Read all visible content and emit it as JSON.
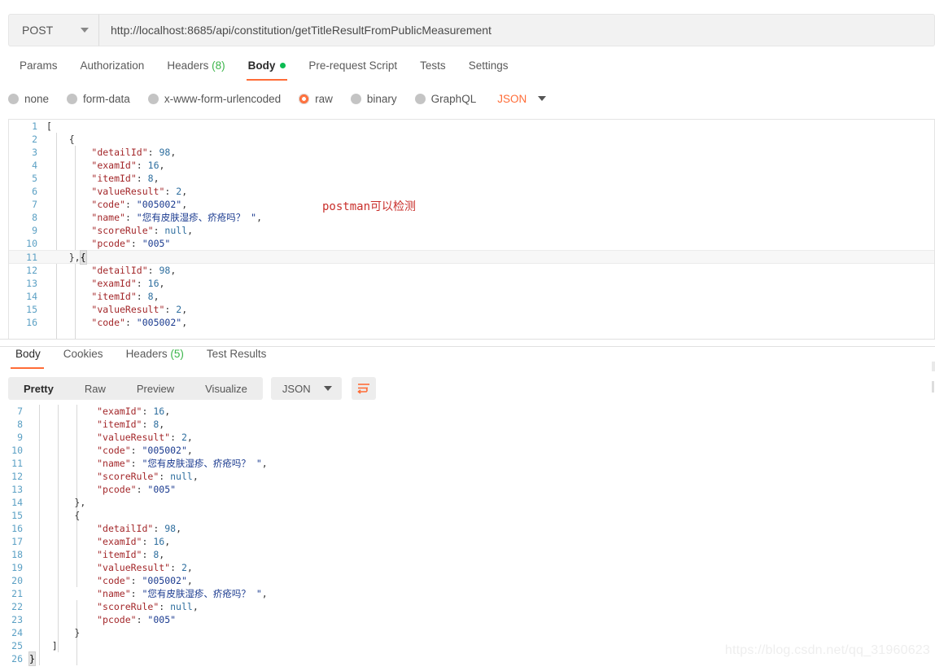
{
  "request": {
    "method": "POST",
    "url": "http://localhost:8685/api/constitution/getTitleResultFromPublicMeasurement",
    "tabs": [
      {
        "label": "Params",
        "active": false,
        "count": "",
        "dot": false
      },
      {
        "label": "Authorization",
        "active": false,
        "count": "",
        "dot": false
      },
      {
        "label": "Headers",
        "active": false,
        "count": "(8)",
        "dot": false
      },
      {
        "label": "Body",
        "active": true,
        "count": "",
        "dot": true
      },
      {
        "label": "Pre-request Script",
        "active": false,
        "count": "",
        "dot": false
      },
      {
        "label": "Tests",
        "active": false,
        "count": "",
        "dot": false
      },
      {
        "label": "Settings",
        "active": false,
        "count": "",
        "dot": false
      }
    ],
    "body_types": [
      {
        "label": "none",
        "checked": false
      },
      {
        "label": "form-data",
        "checked": false
      },
      {
        "label": "x-www-form-urlencoded",
        "checked": false
      },
      {
        "label": "raw",
        "checked": true
      },
      {
        "label": "binary",
        "checked": false
      },
      {
        "label": "GraphQL",
        "checked": false
      }
    ],
    "format": "JSON",
    "code_lines": [
      {
        "n": "1",
        "indent": 0,
        "tokens": [
          {
            "t": "[",
            "c": "br"
          }
        ],
        "hl": false
      },
      {
        "n": "2",
        "indent": 1,
        "tokens": [
          {
            "t": "{",
            "c": "br"
          }
        ],
        "hl": false
      },
      {
        "n": "3",
        "indent": 2,
        "tokens": [
          {
            "t": "\"detailId\"",
            "c": "k"
          },
          {
            "t": ": ",
            "c": "p"
          },
          {
            "t": "98",
            "c": "n"
          },
          {
            "t": ",",
            "c": "p"
          }
        ],
        "hl": false
      },
      {
        "n": "4",
        "indent": 2,
        "tokens": [
          {
            "t": "\"examId\"",
            "c": "k"
          },
          {
            "t": ": ",
            "c": "p"
          },
          {
            "t": "16",
            "c": "n"
          },
          {
            "t": ",",
            "c": "p"
          }
        ],
        "hl": false
      },
      {
        "n": "5",
        "indent": 2,
        "tokens": [
          {
            "t": "\"itemId\"",
            "c": "k"
          },
          {
            "t": ": ",
            "c": "p"
          },
          {
            "t": "8",
            "c": "n"
          },
          {
            "t": ",",
            "c": "p"
          }
        ],
        "hl": false
      },
      {
        "n": "6",
        "indent": 2,
        "tokens": [
          {
            "t": "\"valueResult\"",
            "c": "k"
          },
          {
            "t": ": ",
            "c": "p"
          },
          {
            "t": "2",
            "c": "n"
          },
          {
            "t": ",",
            "c": "p"
          }
        ],
        "hl": false
      },
      {
        "n": "7",
        "indent": 2,
        "tokens": [
          {
            "t": "\"code\"",
            "c": "k"
          },
          {
            "t": ": ",
            "c": "p"
          },
          {
            "t": "\"005002\"",
            "c": "s"
          },
          {
            "t": ",",
            "c": "p"
          }
        ],
        "hl": false
      },
      {
        "n": "8",
        "indent": 2,
        "tokens": [
          {
            "t": "\"name\"",
            "c": "k"
          },
          {
            "t": ": ",
            "c": "p"
          },
          {
            "t": "\"您有皮肤湿疹、疥疮吗？ \"",
            "c": "s"
          },
          {
            "t": ",",
            "c": "p"
          }
        ],
        "hl": false
      },
      {
        "n": "9",
        "indent": 2,
        "tokens": [
          {
            "t": "\"scoreRule\"",
            "c": "k"
          },
          {
            "t": ": ",
            "c": "p"
          },
          {
            "t": "null",
            "c": "nl"
          },
          {
            "t": ",",
            "c": "p"
          }
        ],
        "hl": false
      },
      {
        "n": "10",
        "indent": 2,
        "tokens": [
          {
            "t": "\"pcode\"",
            "c": "k"
          },
          {
            "t": ": ",
            "c": "p"
          },
          {
            "t": "\"005\"",
            "c": "s"
          }
        ],
        "hl": false
      },
      {
        "n": "11",
        "indent": 1,
        "tokens": [
          {
            "t": "},",
            "c": "br"
          },
          {
            "t": "{",
            "c": "cursor"
          }
        ],
        "hl": true
      },
      {
        "n": "12",
        "indent": 2,
        "tokens": [
          {
            "t": "\"detailId\"",
            "c": "k"
          },
          {
            "t": ": ",
            "c": "p"
          },
          {
            "t": "98",
            "c": "n"
          },
          {
            "t": ",",
            "c": "p"
          }
        ],
        "hl": false
      },
      {
        "n": "13",
        "indent": 2,
        "tokens": [
          {
            "t": "\"examId\"",
            "c": "k"
          },
          {
            "t": ": ",
            "c": "p"
          },
          {
            "t": "16",
            "c": "n"
          },
          {
            "t": ",",
            "c": "p"
          }
        ],
        "hl": false
      },
      {
        "n": "14",
        "indent": 2,
        "tokens": [
          {
            "t": "\"itemId\"",
            "c": "k"
          },
          {
            "t": ": ",
            "c": "p"
          },
          {
            "t": "8",
            "c": "n"
          },
          {
            "t": ",",
            "c": "p"
          }
        ],
        "hl": false
      },
      {
        "n": "15",
        "indent": 2,
        "tokens": [
          {
            "t": "\"valueResult\"",
            "c": "k"
          },
          {
            "t": ": ",
            "c": "p"
          },
          {
            "t": "2",
            "c": "n"
          },
          {
            "t": ",",
            "c": "p"
          }
        ],
        "hl": false
      },
      {
        "n": "16",
        "indent": 2,
        "tokens": [
          {
            "t": "\"code\"",
            "c": "k"
          },
          {
            "t": ": ",
            "c": "p"
          },
          {
            "t": "\"005002\"",
            "c": "s"
          },
          {
            "t": ",",
            "c": "p"
          }
        ],
        "hl": false
      }
    ]
  },
  "annotation": {
    "text": "postman可以检测",
    "color": "#c9302c"
  },
  "response": {
    "tabs": [
      {
        "label": "Body",
        "active": true,
        "count": ""
      },
      {
        "label": "Cookies",
        "active": false,
        "count": ""
      },
      {
        "label": "Headers",
        "active": false,
        "count": "(5)"
      },
      {
        "label": "Test Results",
        "active": false,
        "count": ""
      }
    ],
    "view_modes": [
      {
        "label": "Pretty",
        "active": true
      },
      {
        "label": "Raw",
        "active": false
      },
      {
        "label": "Preview",
        "active": false
      },
      {
        "label": "Visualize",
        "active": false
      }
    ],
    "format": "JSON",
    "wrap_icon": "wrap-lines-icon",
    "code_lines": [
      {
        "n": "7",
        "indent": 3,
        "tokens": [
          {
            "t": "\"examId\"",
            "c": "k"
          },
          {
            "t": ": ",
            "c": "p"
          },
          {
            "t": "16",
            "c": "n"
          },
          {
            "t": ",",
            "c": "p"
          }
        ]
      },
      {
        "n": "8",
        "indent": 3,
        "tokens": [
          {
            "t": "\"itemId\"",
            "c": "k"
          },
          {
            "t": ": ",
            "c": "p"
          },
          {
            "t": "8",
            "c": "n"
          },
          {
            "t": ",",
            "c": "p"
          }
        ]
      },
      {
        "n": "9",
        "indent": 3,
        "tokens": [
          {
            "t": "\"valueResult\"",
            "c": "k"
          },
          {
            "t": ": ",
            "c": "p"
          },
          {
            "t": "2",
            "c": "n"
          },
          {
            "t": ",",
            "c": "p"
          }
        ]
      },
      {
        "n": "10",
        "indent": 3,
        "tokens": [
          {
            "t": "\"code\"",
            "c": "k"
          },
          {
            "t": ": ",
            "c": "p"
          },
          {
            "t": "\"005002\"",
            "c": "s"
          },
          {
            "t": ",",
            "c": "p"
          }
        ]
      },
      {
        "n": "11",
        "indent": 3,
        "tokens": [
          {
            "t": "\"name\"",
            "c": "k"
          },
          {
            "t": ": ",
            "c": "p"
          },
          {
            "t": "\"您有皮肤湿疹、疥疮吗？ \"",
            "c": "s"
          },
          {
            "t": ",",
            "c": "p"
          }
        ]
      },
      {
        "n": "12",
        "indent": 3,
        "tokens": [
          {
            "t": "\"scoreRule\"",
            "c": "k"
          },
          {
            "t": ": ",
            "c": "p"
          },
          {
            "t": "null",
            "c": "nl"
          },
          {
            "t": ",",
            "c": "p"
          }
        ]
      },
      {
        "n": "13",
        "indent": 3,
        "tokens": [
          {
            "t": "\"pcode\"",
            "c": "k"
          },
          {
            "t": ": ",
            "c": "p"
          },
          {
            "t": "\"005\"",
            "c": "s"
          }
        ]
      },
      {
        "n": "14",
        "indent": 2,
        "tokens": [
          {
            "t": "},",
            "c": "br"
          }
        ]
      },
      {
        "n": "15",
        "indent": 2,
        "tokens": [
          {
            "t": "{",
            "c": "br"
          }
        ]
      },
      {
        "n": "16",
        "indent": 3,
        "tokens": [
          {
            "t": "\"detailId\"",
            "c": "k"
          },
          {
            "t": ": ",
            "c": "p"
          },
          {
            "t": "98",
            "c": "n"
          },
          {
            "t": ",",
            "c": "p"
          }
        ]
      },
      {
        "n": "17",
        "indent": 3,
        "tokens": [
          {
            "t": "\"examId\"",
            "c": "k"
          },
          {
            "t": ": ",
            "c": "p"
          },
          {
            "t": "16",
            "c": "n"
          },
          {
            "t": ",",
            "c": "p"
          }
        ]
      },
      {
        "n": "18",
        "indent": 3,
        "tokens": [
          {
            "t": "\"itemId\"",
            "c": "k"
          },
          {
            "t": ": ",
            "c": "p"
          },
          {
            "t": "8",
            "c": "n"
          },
          {
            "t": ",",
            "c": "p"
          }
        ]
      },
      {
        "n": "19",
        "indent": 3,
        "tokens": [
          {
            "t": "\"valueResult\"",
            "c": "k"
          },
          {
            "t": ": ",
            "c": "p"
          },
          {
            "t": "2",
            "c": "n"
          },
          {
            "t": ",",
            "c": "p"
          }
        ]
      },
      {
        "n": "20",
        "indent": 3,
        "tokens": [
          {
            "t": "\"code\"",
            "c": "k"
          },
          {
            "t": ": ",
            "c": "p"
          },
          {
            "t": "\"005002\"",
            "c": "s"
          },
          {
            "t": ",",
            "c": "p"
          }
        ]
      },
      {
        "n": "21",
        "indent": 3,
        "tokens": [
          {
            "t": "\"name\"",
            "c": "k"
          },
          {
            "t": ": ",
            "c": "p"
          },
          {
            "t": "\"您有皮肤湿疹、疥疮吗？ \"",
            "c": "s"
          },
          {
            "t": ",",
            "c": "p"
          }
        ]
      },
      {
        "n": "22",
        "indent": 3,
        "tokens": [
          {
            "t": "\"scoreRule\"",
            "c": "k"
          },
          {
            "t": ": ",
            "c": "p"
          },
          {
            "t": "null",
            "c": "nl"
          },
          {
            "t": ",",
            "c": "p"
          }
        ]
      },
      {
        "n": "23",
        "indent": 3,
        "tokens": [
          {
            "t": "\"pcode\"",
            "c": "k"
          },
          {
            "t": ": ",
            "c": "p"
          },
          {
            "t": "\"005\"",
            "c": "s"
          }
        ]
      },
      {
        "n": "24",
        "indent": 2,
        "tokens": [
          {
            "t": "}",
            "c": "br"
          }
        ]
      },
      {
        "n": "25",
        "indent": 1,
        "tokens": [
          {
            "t": "]",
            "c": "br"
          }
        ]
      },
      {
        "n": "26",
        "indent": 0,
        "tokens": [
          {
            "t": "}",
            "c": "cursor2"
          }
        ]
      }
    ]
  },
  "watermark": "https://blog.csdn.net/qq_31960623"
}
